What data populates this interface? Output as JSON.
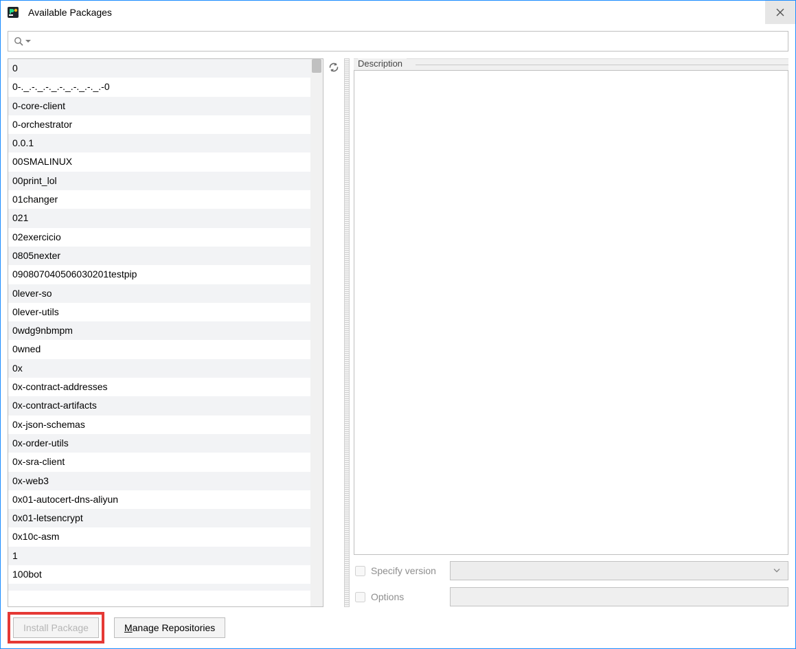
{
  "title": "Available Packages",
  "search": {
    "value": ""
  },
  "packages": [
    "0",
    "0-._.-._.-._.-._.-._.-._.-0",
    "0-core-client",
    "0-orchestrator",
    "0.0.1",
    "00SMALINUX",
    "00print_lol",
    "01changer",
    "021",
    "02exercicio",
    "0805nexter",
    "090807040506030201testpip",
    "0lever-so",
    "0lever-utils",
    "0wdg9nbmpm",
    "0wned",
    "0x",
    "0x-contract-addresses",
    "0x-contract-artifacts",
    "0x-json-schemas",
    "0x-order-utils",
    "0x-sra-client",
    "0x-web3",
    "0x01-autocert-dns-aliyun",
    "0x01-letsencrypt",
    "0x10c-asm",
    "1",
    "100bot"
  ],
  "right": {
    "description_label": "Description",
    "specify_version_label": "Specify version",
    "specify_version_checked": false,
    "options_label": "Options",
    "options_checked": false,
    "options_value": ""
  },
  "buttons": {
    "install": "Install Package",
    "manage_repositories_rest": "anage Repositories",
    "manage_repositories_mnemonic": "M"
  },
  "icons": {
    "app": "pycharm-icon",
    "close": "close-icon",
    "search": "search-icon",
    "refresh": "refresh-icon",
    "chevron_down": "chevron-down-icon"
  }
}
